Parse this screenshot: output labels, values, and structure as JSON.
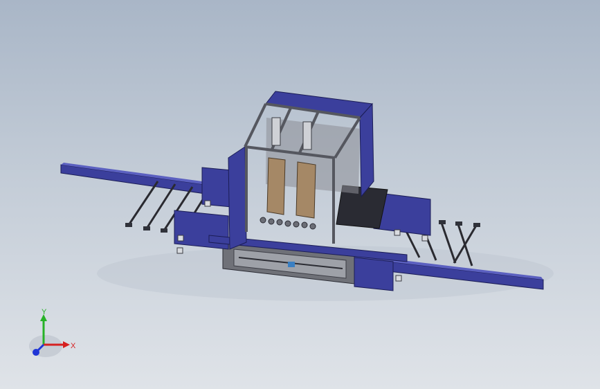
{
  "viewport": {
    "background_top": "#a9b6c7",
    "background_bottom": "#dfe3e8"
  },
  "model": {
    "frame_color": "#3a3f9a",
    "frame_dark": "#23266b",
    "metal_color": "#7d7f87",
    "tan_color": "#a58866"
  },
  "triad": {
    "x_label": "X",
    "y_label": "Y",
    "x_color": "#d62020",
    "y_color": "#27b227",
    "z_color": "#2036d6"
  }
}
